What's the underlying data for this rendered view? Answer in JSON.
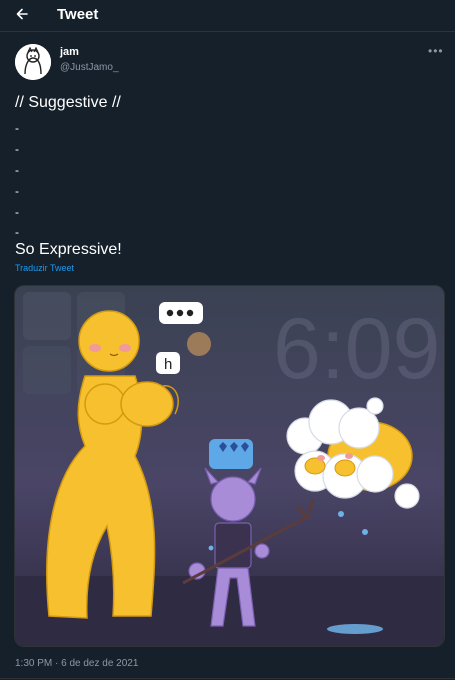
{
  "header": {
    "title": "Tweet",
    "back_icon": "arrow-left-icon"
  },
  "author": {
    "name": "jam",
    "handle": "@JustJamo_"
  },
  "tweet": {
    "line1": "// Suggestive //",
    "dashes": [
      "-",
      "-",
      "-",
      "-",
      "-",
      "-"
    ],
    "line2": "So Expressive!",
    "translate": "Traduzir Tweet"
  },
  "media": {
    "clock_text": "6:09",
    "bubble_h": "h"
  },
  "timestamp": "1:30 PM · 6 de dez de 2021",
  "colors": {
    "background": "#15202b",
    "link": "#1d9bf0",
    "muted": "#8b98a5",
    "character": "#f6c02e",
    "imp": "#a98cd8"
  }
}
